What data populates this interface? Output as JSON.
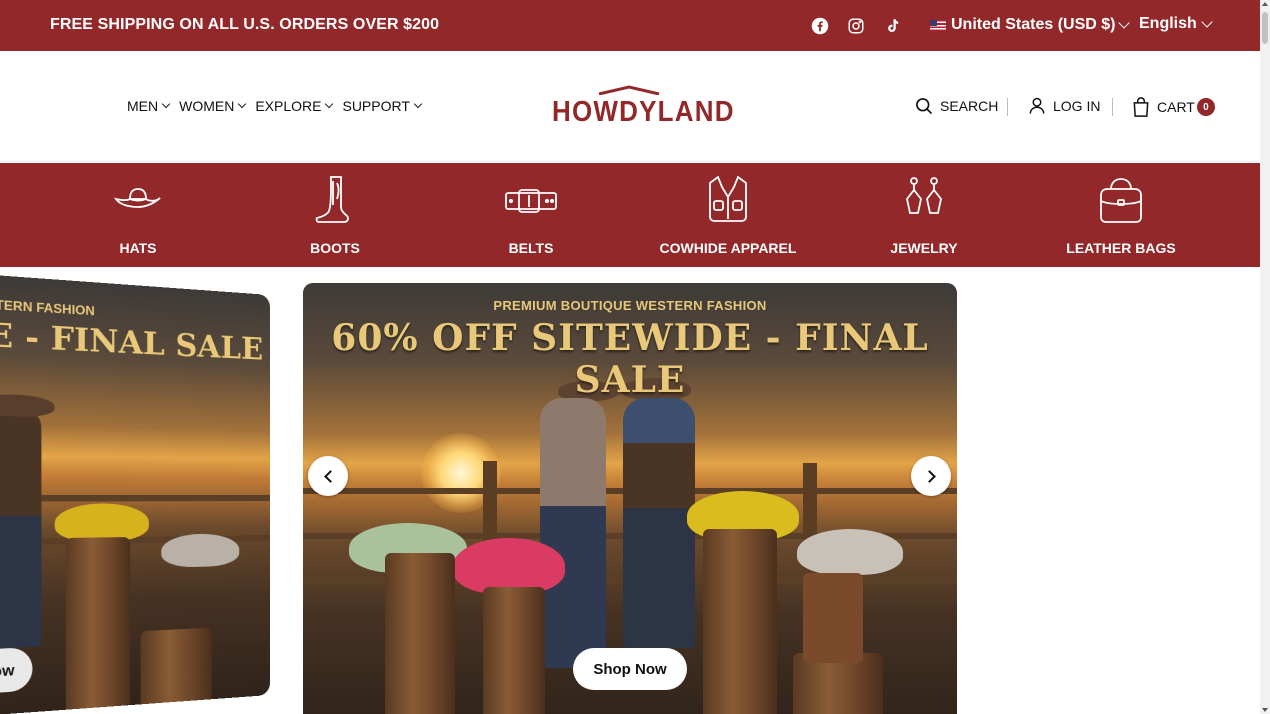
{
  "announcement": {
    "message": "FREE SHIPPING ON ALL U.S. ORDERS OVER $200",
    "social_icons": [
      "facebook-icon",
      "instagram-icon",
      "tiktok-icon"
    ],
    "currency": "United States (USD $)",
    "language": "English"
  },
  "header": {
    "nav": [
      {
        "label": "MEN"
      },
      {
        "label": "WOMEN"
      },
      {
        "label": "EXPLORE"
      },
      {
        "label": "SUPPORT"
      }
    ],
    "logo": "HOWDYLAND",
    "search_label": "SEARCH",
    "login_label": "LOG IN",
    "cart_label": "CART",
    "cart_count": "0"
  },
  "categories": [
    {
      "label": "HATS",
      "icon": "hat-icon"
    },
    {
      "label": "BOOTS",
      "icon": "boot-icon"
    },
    {
      "label": "BELTS",
      "icon": "belt-icon"
    },
    {
      "label": "COWHIDE APPAREL",
      "icon": "vest-icon"
    },
    {
      "label": "JEWELRY",
      "icon": "earrings-icon"
    },
    {
      "label": "LEATHER BAGS",
      "icon": "bag-icon"
    }
  ],
  "hero": {
    "tagline": "PREMIUM BOUTIQUE WESTERN FASHION",
    "headline": "60% OFF SITEWIDE - FINAL SALE",
    "cta": "Shop Now",
    "side_slide": {
      "tagline": "UE WESTERN FASHION",
      "headline": "IDE - FINAL SALE",
      "cta": "p Now"
    }
  },
  "colors": {
    "brand": "#93282a",
    "headline_gold": "#e9c979"
  }
}
